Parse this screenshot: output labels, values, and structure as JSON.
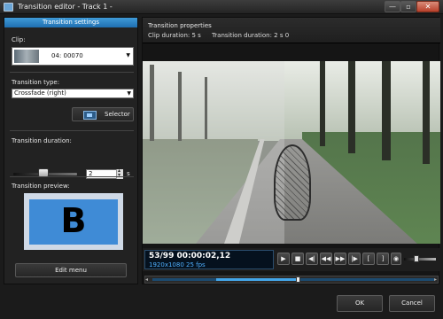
{
  "window": {
    "title": "Transition editor - Track 1 -",
    "min_label": "—",
    "max_label": "▫",
    "close_label": "✕"
  },
  "left_panel": {
    "header": "Transition settings",
    "clip_label": "Clip:",
    "clip_value": "04: 00070",
    "transition_type_label": "Transition type:",
    "transition_type_value": "Crossfade (right)",
    "selector_label": "Selector",
    "transition_duration_label": "Transition duration:",
    "duration_value": "2",
    "duration_unit": "s",
    "transition_preview_label": "Transition preview:",
    "preview_letter": "B",
    "edit_menu_label": "Edit menu"
  },
  "properties": {
    "title": "Transition properties",
    "clip_duration": "Clip duration:   5 s",
    "transition_duration": "Transition duration:   2 s 0"
  },
  "transport": {
    "time_main": "53/99  00:00:02,12",
    "time_sub": "1920x1080 25  fps",
    "buttons": [
      "▶",
      "■",
      "◀|",
      "◀◀",
      "▶▶",
      "|▶",
      "[",
      "]"
    ]
  },
  "footer": {
    "ok_label": "OK",
    "cancel_label": "Cancel"
  },
  "colors": {
    "accent": "#2f86c8",
    "timecode": "#4fb0ff"
  }
}
